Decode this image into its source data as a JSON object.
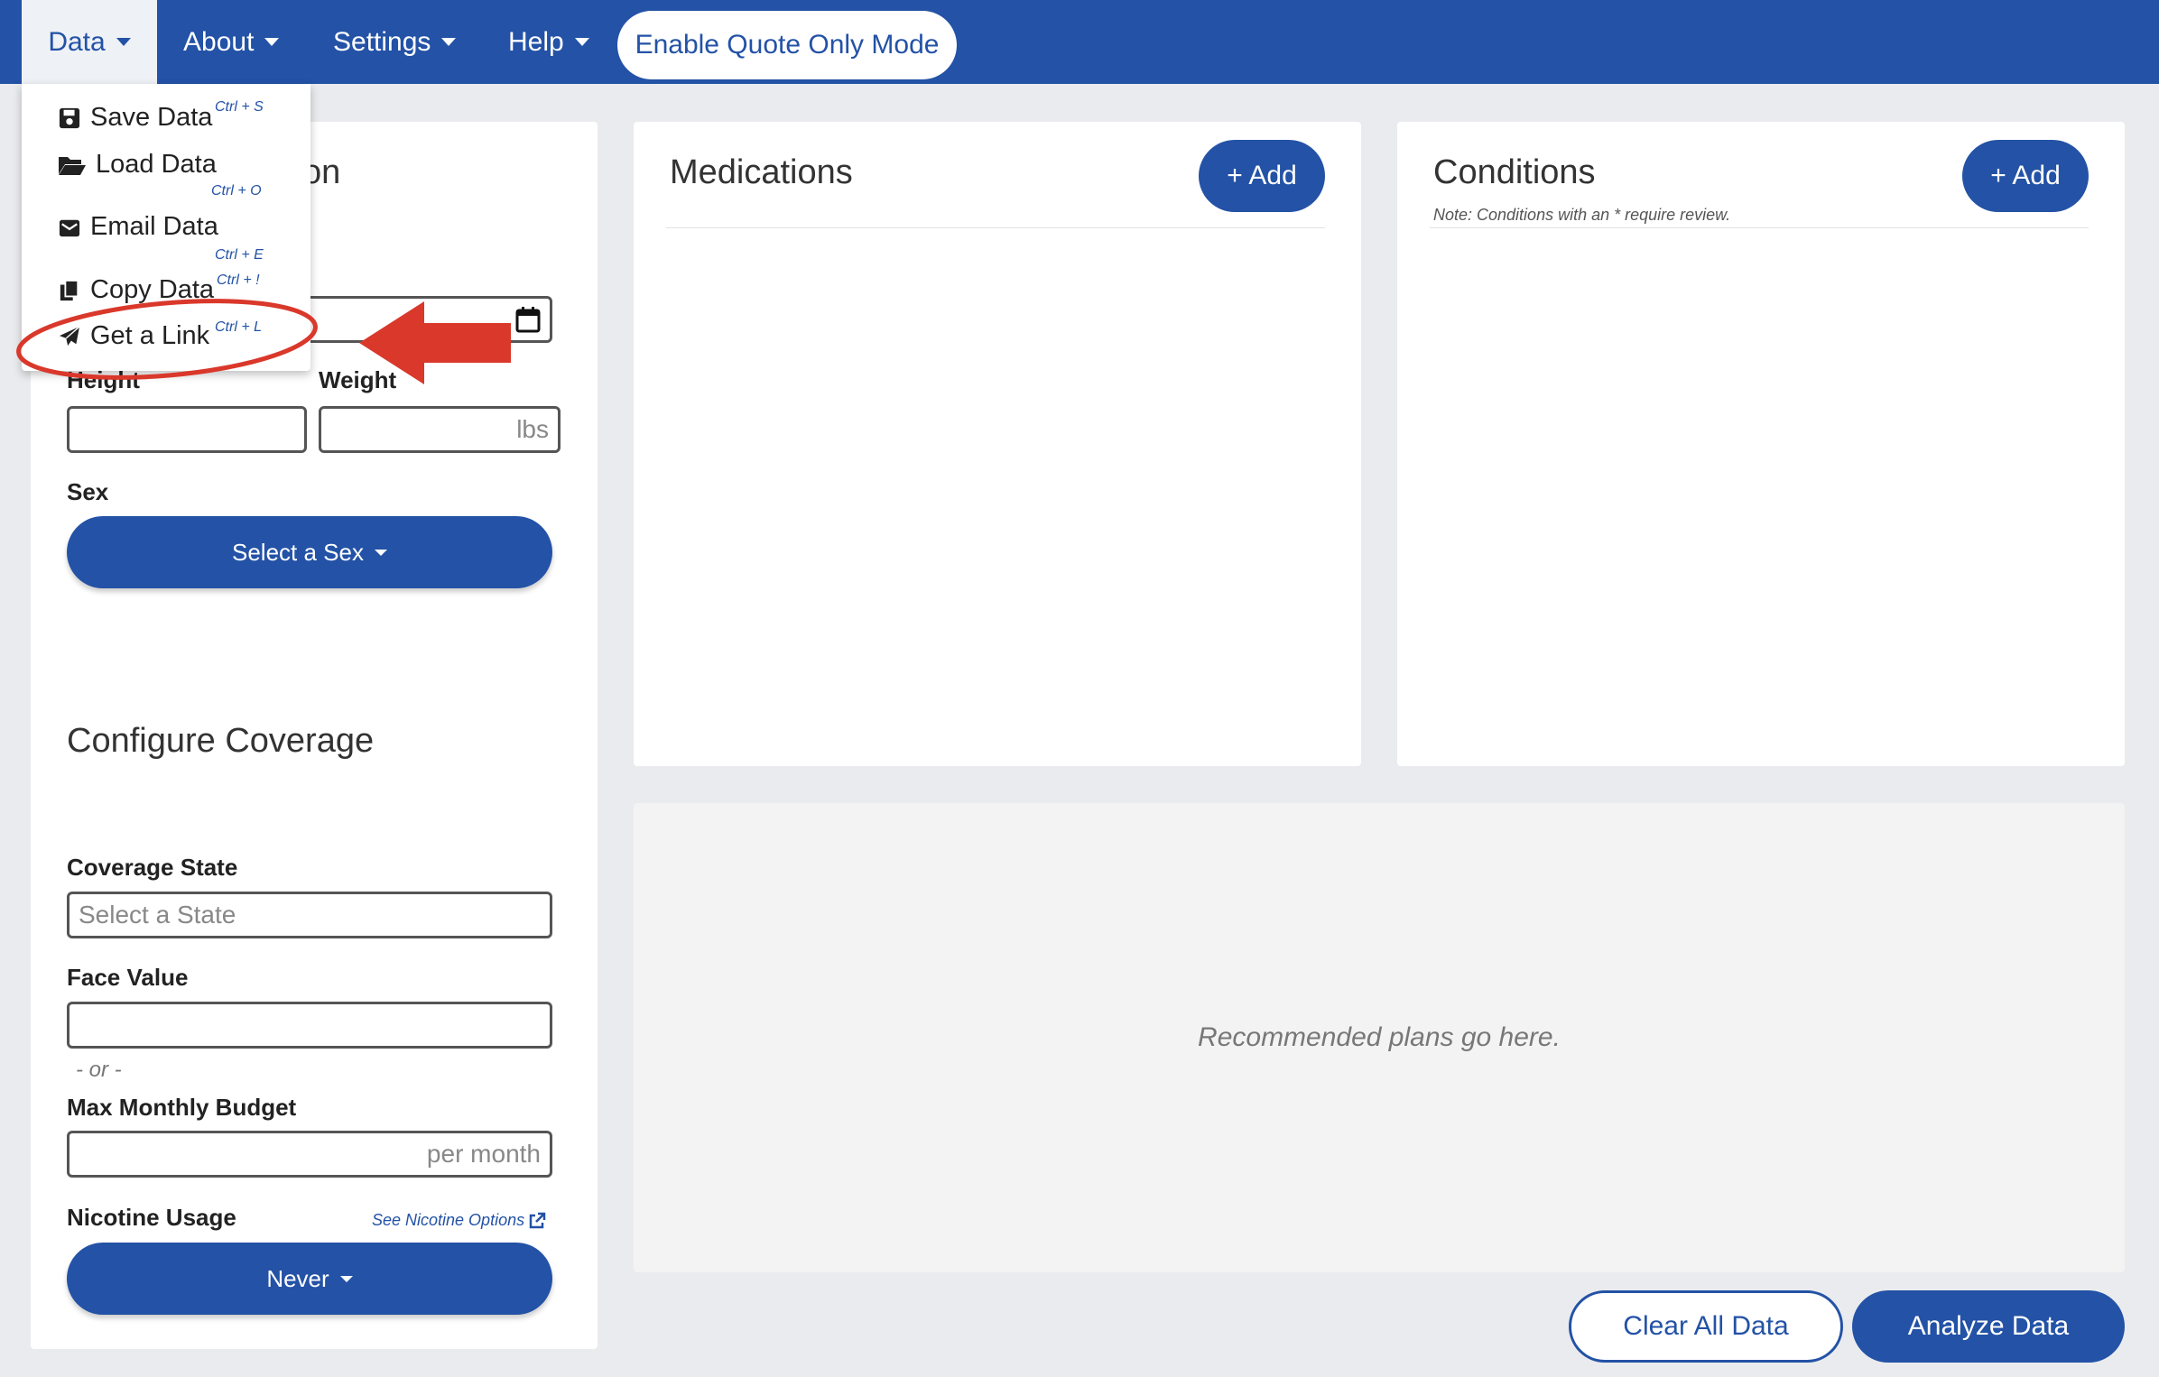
{
  "nav": {
    "data": "Data",
    "about": "About",
    "settings": "Settings",
    "help": "Help",
    "quote_mode": "Enable Quote Only Mode"
  },
  "dropdown": {
    "items": [
      {
        "label": "Save Data",
        "shortcut": "Ctrl + S",
        "icon": "save-icon"
      },
      {
        "label": "Load Data",
        "shortcut": "Ctrl + O",
        "icon": "folder-open-icon"
      },
      {
        "label": "Email Data",
        "shortcut": "Ctrl + E",
        "icon": "email-icon"
      },
      {
        "label": "Copy Data",
        "shortcut": "Ctrl + !",
        "icon": "copy-icon"
      },
      {
        "label": "Get a Link",
        "shortcut": "Ctrl + L",
        "icon": "paper-plane-icon"
      }
    ]
  },
  "left": {
    "title_fragment": "on",
    "height_label": "Height",
    "weight_label": "Weight",
    "weight_unit": "lbs",
    "sex_label": "Sex",
    "sex_button": "Select a Sex",
    "coverage_title": "Configure Coverage",
    "state_label": "Coverage State",
    "state_placeholder": "Select a State",
    "face_label": "Face Value",
    "or_text": "- or -",
    "budget_label": "Max Monthly Budget",
    "budget_unit": "per month",
    "nicotine_label": "Nicotine Usage",
    "nicotine_link": "See Nicotine Options",
    "nicotine_button": "Never"
  },
  "medications": {
    "title": "Medications",
    "add": "+ Add"
  },
  "conditions": {
    "title": "Conditions",
    "add": "+ Add",
    "note": "Note: Conditions with an * require review."
  },
  "plans": {
    "placeholder": "Recommended plans go here."
  },
  "footer": {
    "clear": "Clear All Data",
    "analyze": "Analyze Data"
  },
  "colors": {
    "primary": "#2352a6",
    "highlight": "#d9382b"
  }
}
